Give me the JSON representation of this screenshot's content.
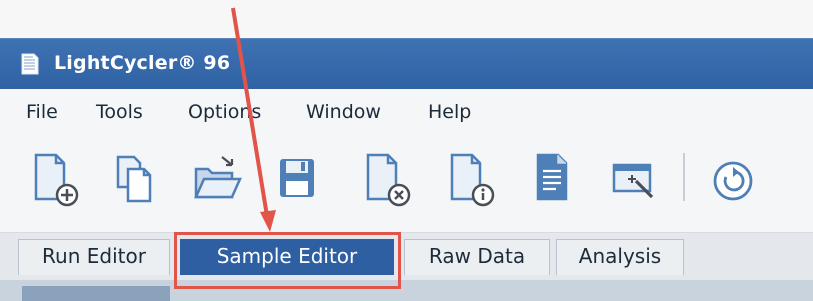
{
  "window": {
    "title": "LightCycler® 96",
    "app_icon": "lightcycler-app-icon"
  },
  "menu": {
    "items": [
      {
        "label": "File"
      },
      {
        "label": "Tools"
      },
      {
        "label": "Options"
      },
      {
        "label": "Window"
      },
      {
        "label": "Help"
      }
    ]
  },
  "toolbar": {
    "buttons": [
      {
        "icon": "new-document-icon"
      },
      {
        "icon": "copy-document-icon"
      },
      {
        "icon": "open-folder-icon"
      },
      {
        "icon": "save-icon"
      },
      {
        "icon": "close-document-icon"
      },
      {
        "icon": "document-info-icon"
      },
      {
        "icon": "report-icon"
      },
      {
        "icon": "screen-capture-icon"
      },
      {
        "icon": "refresh-icon"
      }
    ]
  },
  "tabs": {
    "items": [
      {
        "label": "Run Editor",
        "active": false
      },
      {
        "label": "Sample Editor",
        "active": true
      },
      {
        "label": "Raw Data",
        "active": false
      },
      {
        "label": "Analysis",
        "active": false
      }
    ]
  },
  "annotation": {
    "color": "#e2534a",
    "highlighted_tab": "Sample Editor"
  },
  "colors": {
    "titlebar": "#3e72b3",
    "active_tab": "#2d5fa2",
    "icon_blue": "#4f7fb7"
  }
}
